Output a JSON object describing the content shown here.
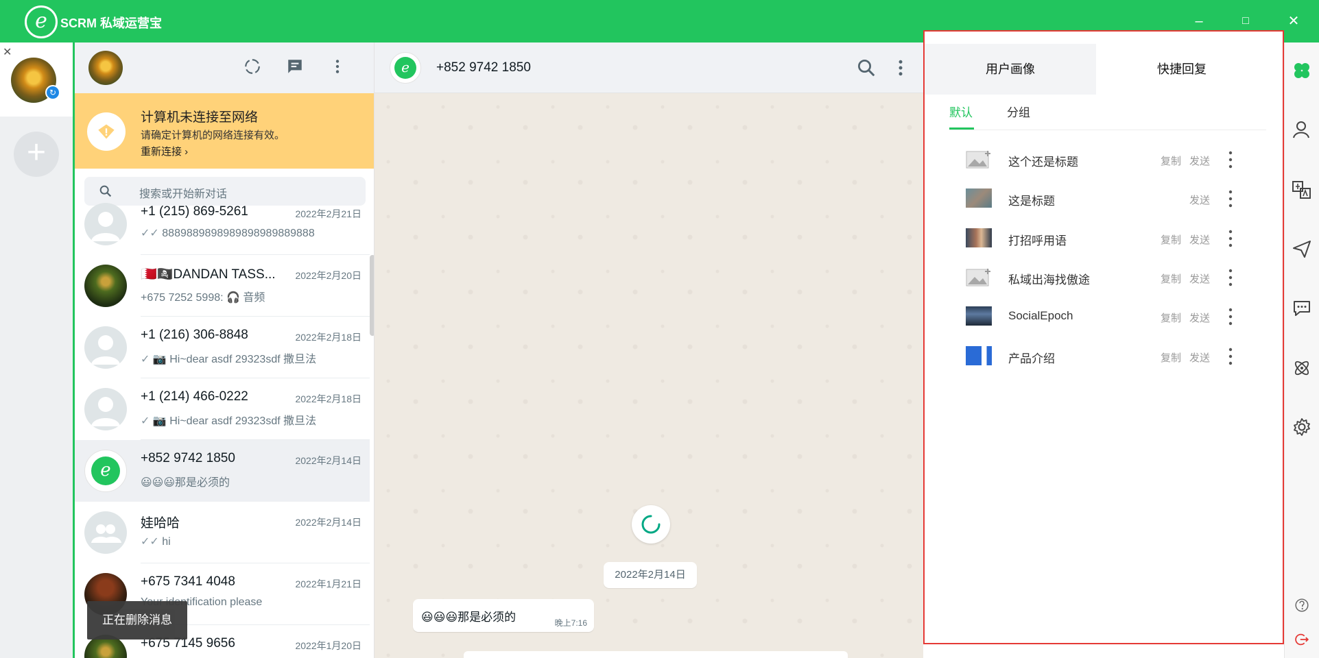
{
  "app": {
    "title": "SCRM 私域运营宝",
    "logo_letter": "e",
    "window_buttons": {
      "minimize": "–",
      "maximize": "□",
      "close": "✕"
    }
  },
  "accounts": {
    "close_symbol": "✕",
    "add_symbol": "+",
    "badge_symbol": "↻"
  },
  "warning": {
    "title": "计算机未连接至网络",
    "subtitle": "请确定计算机的网络连接有效。",
    "link": "重新连接 ›"
  },
  "search": {
    "placeholder": "搜索或开始新对话"
  },
  "chats": [
    {
      "name": "+1 (215) 869-5261",
      "date": "2022年2月21日",
      "preview": "8889889898989898989889888",
      "tick": "✓✓"
    },
    {
      "name": "🇧🇭🏴‍☠️DANDAN TASS...",
      "date": "2022年2月20日",
      "preview": "+675 7252 5998: 🎧 音频",
      "tick": ""
    },
    {
      "name": "+1 (216) 306-8848",
      "date": "2022年2月18日",
      "preview": "📷 Hi~dear asdf 29323sdf 撒旦法",
      "tick": "✓"
    },
    {
      "name": "+1 (214) 466-0222",
      "date": "2022年2月18日",
      "preview": "📷 Hi~dear asdf 29323sdf 撒旦法",
      "tick": "✓"
    },
    {
      "name": "+852 9742 1850",
      "date": "2022年2月14日",
      "preview": "😃😃😃那是必须的",
      "tick": ""
    },
    {
      "name": "娃哈哈",
      "date": "2022年2月14日",
      "preview": "hi",
      "tick": "✓✓"
    },
    {
      "name": "+675 7341 4048",
      "date": "2022年1月21日",
      "preview": "Your identification please",
      "tick": ""
    },
    {
      "name": "+675 7145 9656",
      "date": "2022年1月20日",
      "preview": "",
      "tick": ""
    }
  ],
  "toast": "正在删除消息",
  "conversation": {
    "title": "+852 9742 1850",
    "date_chip": "2022年2月14日",
    "message": {
      "text": "😃😃😃那是必须的",
      "time": "晚上7:16"
    }
  },
  "side_panel": {
    "tabs": [
      "用户画像",
      "快捷回复"
    ],
    "subtabs": [
      "默认",
      "分组"
    ],
    "replies": [
      {
        "title": "这个还是标题",
        "copy": "复制",
        "send": "发送",
        "thumb": "placeholder"
      },
      {
        "title": "这是标题",
        "copy": "",
        "send": "发送",
        "thumb": "img1"
      },
      {
        "title": "打招呼用语",
        "copy": "复制",
        "send": "发送",
        "thumb": "img2"
      },
      {
        "title": "私域出海找傲途",
        "copy": "复制",
        "send": "发送",
        "thumb": "placeholder"
      },
      {
        "title": "SocialEpoch",
        "copy": "复制",
        "send": "发送",
        "thumb": "img3"
      },
      {
        "title": "产品介绍",
        "copy": "复制",
        "send": "发送",
        "thumb": "img4"
      }
    ]
  },
  "colors": {
    "brand": "#22c55e",
    "highlight_border": "#e53935",
    "banner": "#ffd279"
  }
}
